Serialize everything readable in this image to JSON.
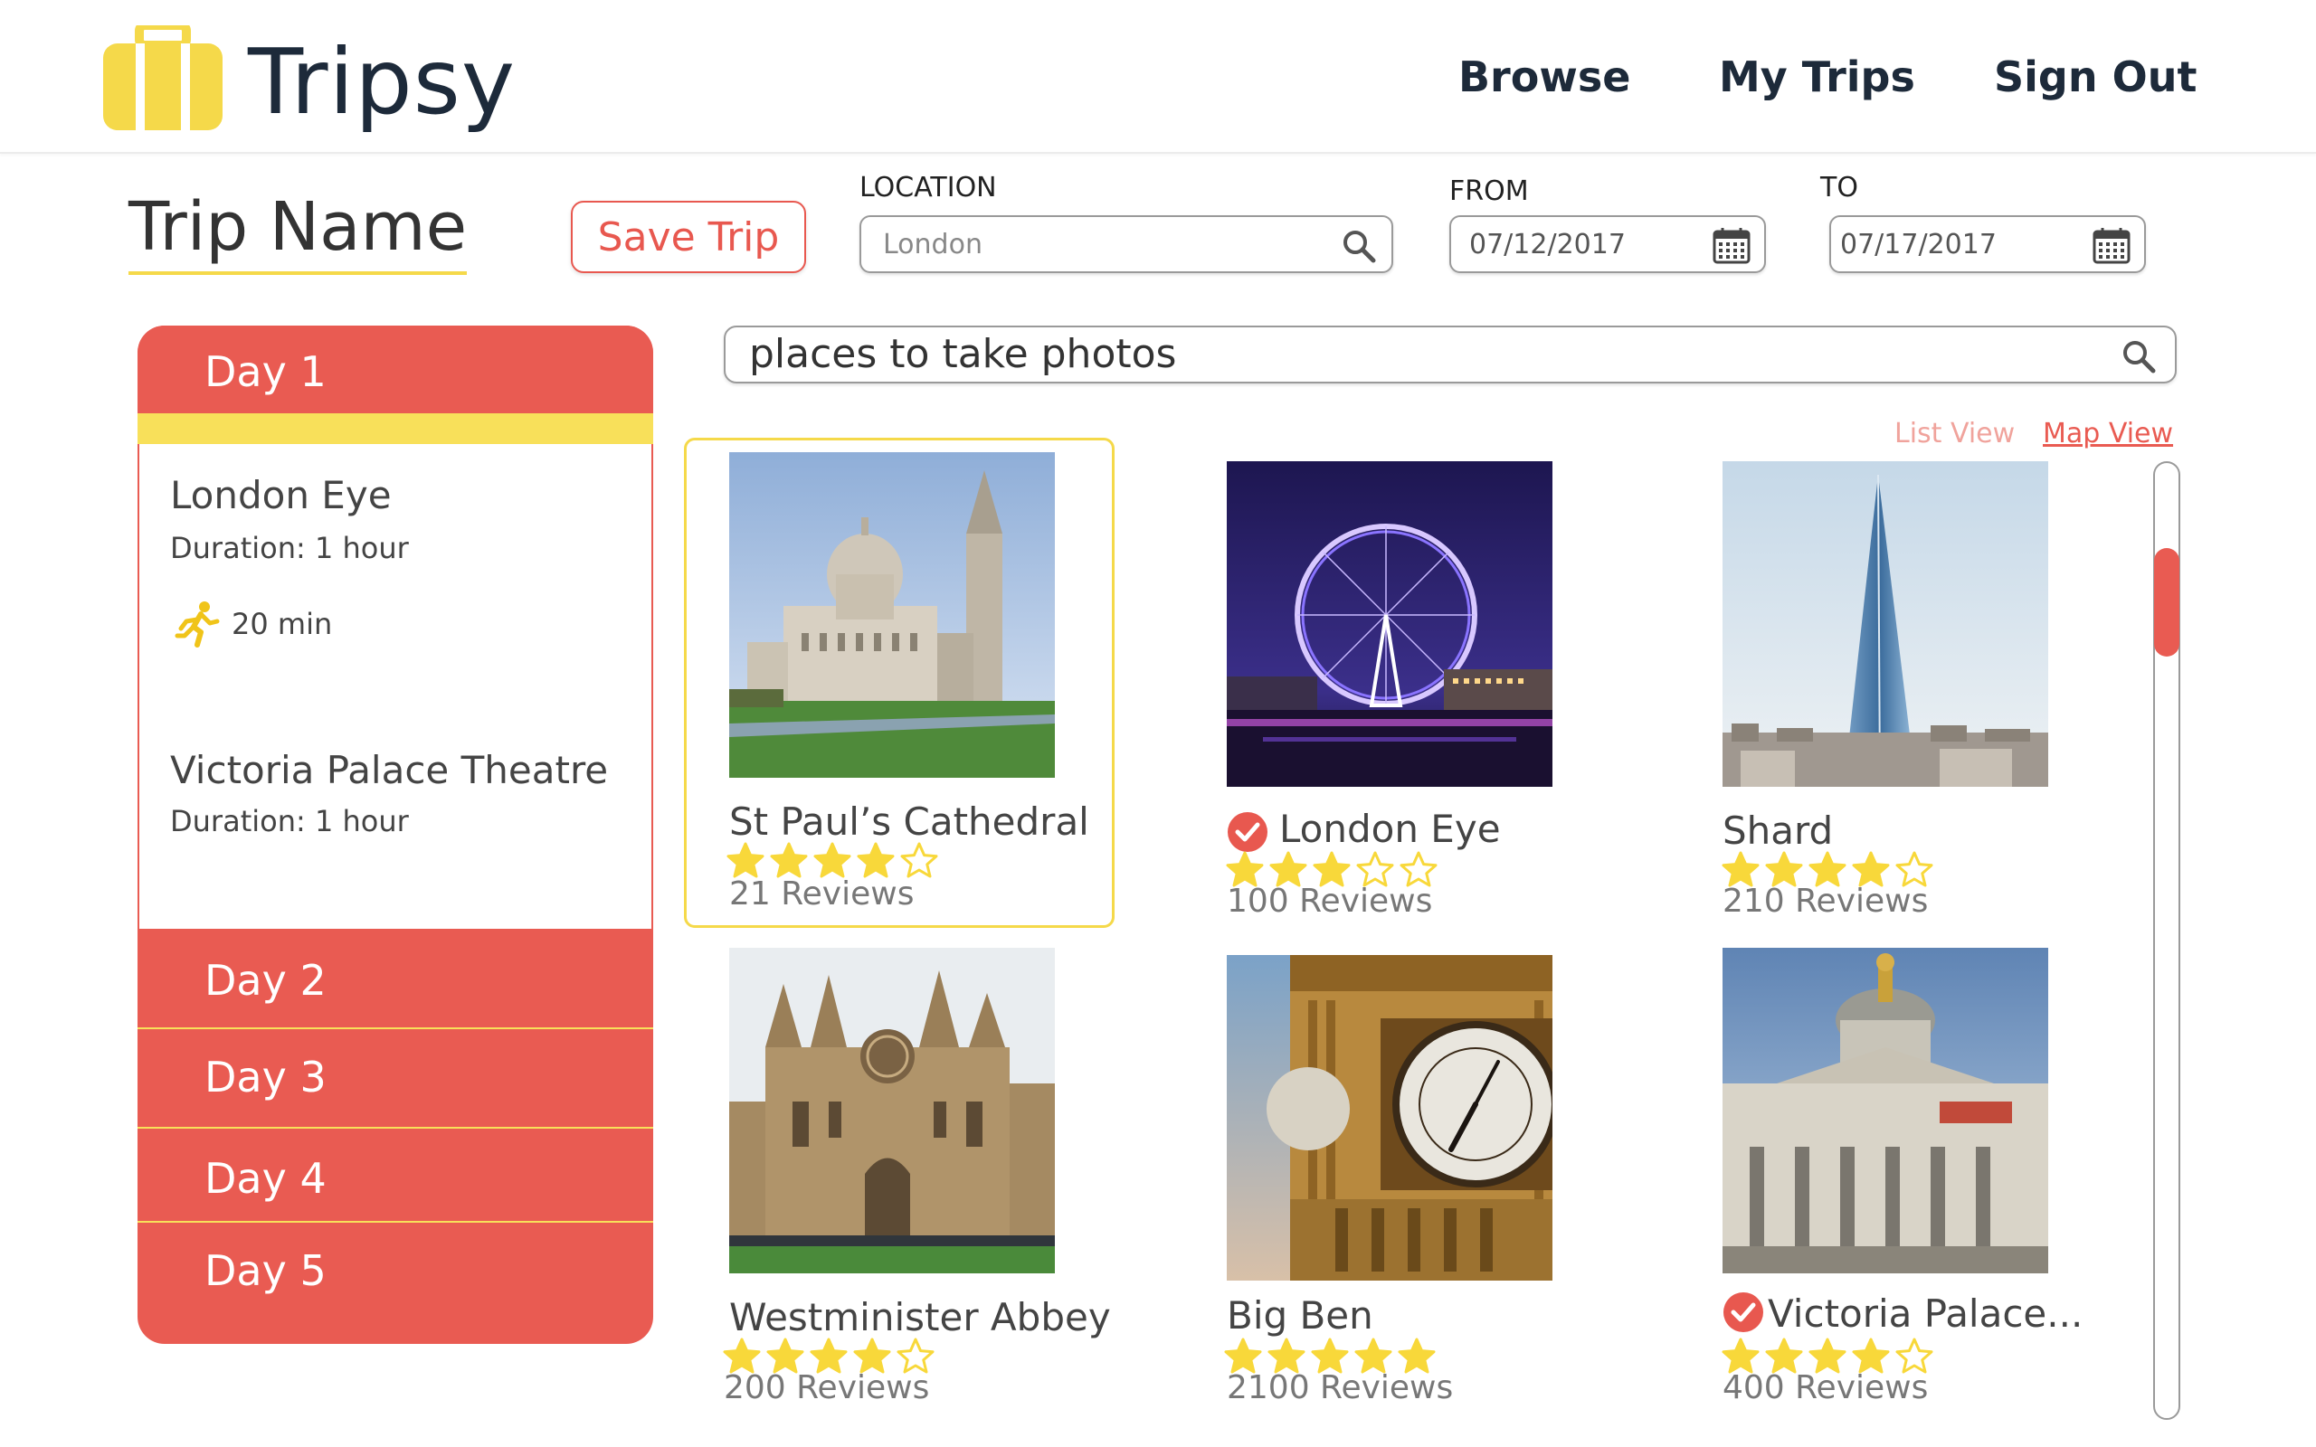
{
  "app": {
    "name": "Tripsy"
  },
  "nav": {
    "browse": "Browse",
    "my_trips": "My Trips",
    "sign_out": "Sign Out"
  },
  "trip": {
    "name": "Trip Name",
    "save_label": "Save Trip"
  },
  "filters": {
    "location_label": "LOCATION",
    "location_value": "London",
    "from_label": "FROM",
    "from_value": "07/12/2017",
    "to_label": "TO",
    "to_value": "07/17/2017"
  },
  "itinerary": {
    "active_day": "Day 1",
    "activities": [
      {
        "name": "London Eye",
        "duration": "Duration: 1 hour"
      },
      {
        "name": "Victoria Palace Theatre",
        "duration": "Duration: 1 hour"
      }
    ],
    "travel_time": "20 min",
    "other_days": [
      "Day 2",
      "Day 3",
      "Day 4",
      "Day 5"
    ]
  },
  "search": {
    "query": "places to take photos"
  },
  "views": {
    "list": "List View",
    "map": "Map View"
  },
  "results": [
    {
      "title": "St Paul’s Cathedral",
      "rating": 4,
      "reviews": "21 Reviews",
      "added": false,
      "selected": true
    },
    {
      "title": "London Eye",
      "rating": 3,
      "reviews": "100 Reviews",
      "added": true,
      "selected": false
    },
    {
      "title": "Shard",
      "rating": 4,
      "reviews": "210 Reviews",
      "added": false,
      "selected": false
    },
    {
      "title": "Westminister Abbey",
      "rating": 4,
      "reviews": "200 Reviews",
      "added": false,
      "selected": false
    },
    {
      "title": "Big Ben",
      "rating": 5,
      "reviews": "2100 Reviews",
      "added": false,
      "selected": false
    },
    {
      "title": "Victoria Palace...",
      "rating": 4,
      "reviews": "400 Reviews",
      "added": true,
      "selected": false
    }
  ],
  "colors": {
    "accent_red": "#e95b52",
    "accent_yellow": "#f8e05a",
    "text_dark": "#1d2a3a"
  }
}
